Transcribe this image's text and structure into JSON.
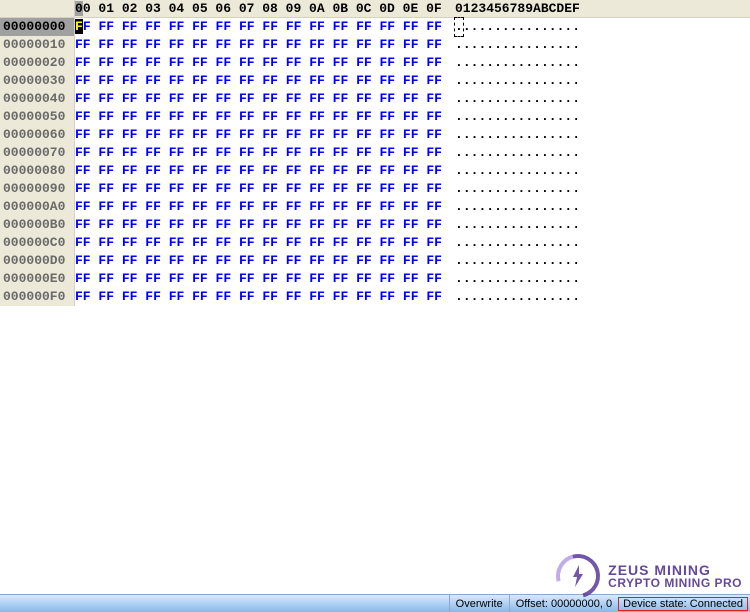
{
  "header": {
    "hex_cols": [
      "00",
      "01",
      "02",
      "03",
      "04",
      "05",
      "06",
      "07",
      "08",
      "09",
      "0A",
      "0B",
      "0C",
      "0D",
      "0E",
      "0F"
    ],
    "ascii_label": "0123456789ABCDEF"
  },
  "cursor": {
    "row": 0,
    "col": 0
  },
  "rows": [
    {
      "offset": "00000000",
      "bytes": [
        "FF",
        "FF",
        "FF",
        "FF",
        "FF",
        "FF",
        "FF",
        "FF",
        "FF",
        "FF",
        "FF",
        "FF",
        "FF",
        "FF",
        "FF",
        "FF"
      ]
    },
    {
      "offset": "00000010",
      "bytes": [
        "FF",
        "FF",
        "FF",
        "FF",
        "FF",
        "FF",
        "FF",
        "FF",
        "FF",
        "FF",
        "FF",
        "FF",
        "FF",
        "FF",
        "FF",
        "FF"
      ]
    },
    {
      "offset": "00000020",
      "bytes": [
        "FF",
        "FF",
        "FF",
        "FF",
        "FF",
        "FF",
        "FF",
        "FF",
        "FF",
        "FF",
        "FF",
        "FF",
        "FF",
        "FF",
        "FF",
        "FF"
      ]
    },
    {
      "offset": "00000030",
      "bytes": [
        "FF",
        "FF",
        "FF",
        "FF",
        "FF",
        "FF",
        "FF",
        "FF",
        "FF",
        "FF",
        "FF",
        "FF",
        "FF",
        "FF",
        "FF",
        "FF"
      ]
    },
    {
      "offset": "00000040",
      "bytes": [
        "FF",
        "FF",
        "FF",
        "FF",
        "FF",
        "FF",
        "FF",
        "FF",
        "FF",
        "FF",
        "FF",
        "FF",
        "FF",
        "FF",
        "FF",
        "FF"
      ]
    },
    {
      "offset": "00000050",
      "bytes": [
        "FF",
        "FF",
        "FF",
        "FF",
        "FF",
        "FF",
        "FF",
        "FF",
        "FF",
        "FF",
        "FF",
        "FF",
        "FF",
        "FF",
        "FF",
        "FF"
      ]
    },
    {
      "offset": "00000060",
      "bytes": [
        "FF",
        "FF",
        "FF",
        "FF",
        "FF",
        "FF",
        "FF",
        "FF",
        "FF",
        "FF",
        "FF",
        "FF",
        "FF",
        "FF",
        "FF",
        "FF"
      ]
    },
    {
      "offset": "00000070",
      "bytes": [
        "FF",
        "FF",
        "FF",
        "FF",
        "FF",
        "FF",
        "FF",
        "FF",
        "FF",
        "FF",
        "FF",
        "FF",
        "FF",
        "FF",
        "FF",
        "FF"
      ]
    },
    {
      "offset": "00000080",
      "bytes": [
        "FF",
        "FF",
        "FF",
        "FF",
        "FF",
        "FF",
        "FF",
        "FF",
        "FF",
        "FF",
        "FF",
        "FF",
        "FF",
        "FF",
        "FF",
        "FF"
      ]
    },
    {
      "offset": "00000090",
      "bytes": [
        "FF",
        "FF",
        "FF",
        "FF",
        "FF",
        "FF",
        "FF",
        "FF",
        "FF",
        "FF",
        "FF",
        "FF",
        "FF",
        "FF",
        "FF",
        "FF"
      ]
    },
    {
      "offset": "000000A0",
      "bytes": [
        "FF",
        "FF",
        "FF",
        "FF",
        "FF",
        "FF",
        "FF",
        "FF",
        "FF",
        "FF",
        "FF",
        "FF",
        "FF",
        "FF",
        "FF",
        "FF"
      ]
    },
    {
      "offset": "000000B0",
      "bytes": [
        "FF",
        "FF",
        "FF",
        "FF",
        "FF",
        "FF",
        "FF",
        "FF",
        "FF",
        "FF",
        "FF",
        "FF",
        "FF",
        "FF",
        "FF",
        "FF"
      ]
    },
    {
      "offset": "000000C0",
      "bytes": [
        "FF",
        "FF",
        "FF",
        "FF",
        "FF",
        "FF",
        "FF",
        "FF",
        "FF",
        "FF",
        "FF",
        "FF",
        "FF",
        "FF",
        "FF",
        "FF"
      ]
    },
    {
      "offset": "000000D0",
      "bytes": [
        "FF",
        "FF",
        "FF",
        "FF",
        "FF",
        "FF",
        "FF",
        "FF",
        "FF",
        "FF",
        "FF",
        "FF",
        "FF",
        "FF",
        "FF",
        "FF"
      ]
    },
    {
      "offset": "000000E0",
      "bytes": [
        "FF",
        "FF",
        "FF",
        "FF",
        "FF",
        "FF",
        "FF",
        "FF",
        "FF",
        "FF",
        "FF",
        "FF",
        "FF",
        "FF",
        "FF",
        "FF"
      ]
    },
    {
      "offset": "000000F0",
      "bytes": [
        "FF",
        "FF",
        "FF",
        "FF",
        "FF",
        "FF",
        "FF",
        "FF",
        "FF",
        "FF",
        "FF",
        "FF",
        "FF",
        "FF",
        "FF",
        "FF"
      ]
    }
  ],
  "status": {
    "mode": "Overwrite",
    "offset": "Offset: 00000000, 0",
    "device": "Device state: Connected"
  },
  "watermark": {
    "line1": "ZEUS MINING",
    "line2": "CRYPTO MINING PRO"
  }
}
